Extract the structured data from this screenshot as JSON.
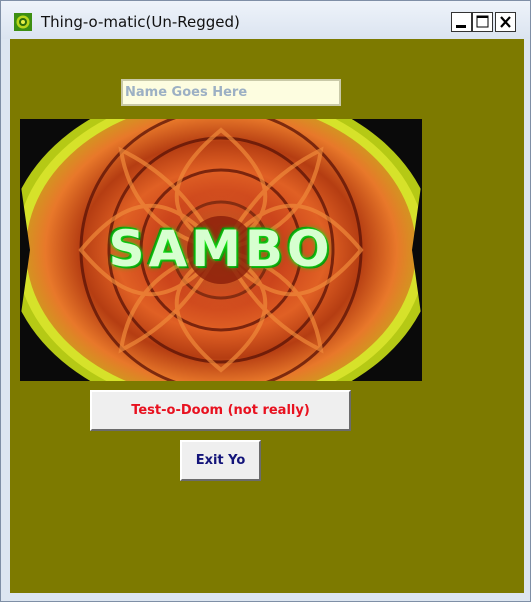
{
  "window": {
    "title": "Thing-o-matic(Un-Regged)",
    "icon": "app-gear-icon",
    "controls": [
      "minimize-icon",
      "maximize-icon",
      "close-icon"
    ]
  },
  "form": {
    "name_placeholder": "Name Goes Here",
    "name_value": ""
  },
  "artwork": {
    "text": "SAMBO"
  },
  "buttons": {
    "test_label": "Test-o-Doom (not really)",
    "exit_label": "Exit Yo"
  },
  "colors": {
    "background": "#7d7a00",
    "test_text": "#e8111f",
    "exit_text": "#13147a"
  }
}
